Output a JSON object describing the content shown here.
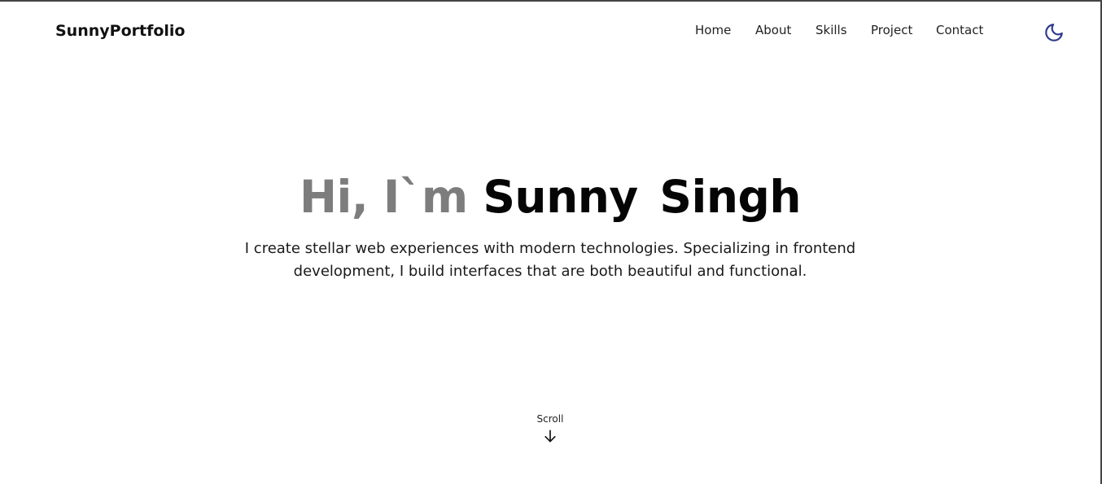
{
  "navbar": {
    "brand": "SunnyPortfolio",
    "links": [
      "Home",
      "About",
      "Skills",
      "Project",
      "Contact"
    ],
    "theme_toggle_icon": "moon-icon",
    "theme_toggle_color": "#2d3a8c"
  },
  "hero": {
    "greeting": "Hi, I`m",
    "name": "Sunny Singh",
    "description": "I create stellar web experiences with modern technologies. Specializing in frontend development, I build interfaces that are both beautiful and functional."
  },
  "scroll": {
    "label": "Scroll",
    "icon": "arrow-down-icon"
  }
}
